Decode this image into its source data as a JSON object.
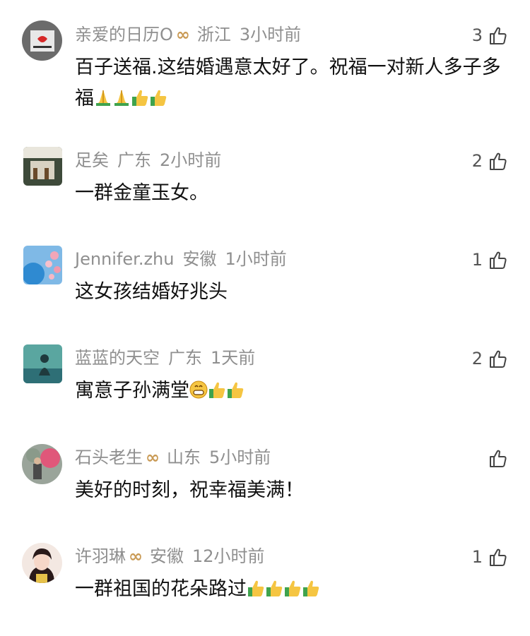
{
  "comments": [
    {
      "user": "亲爱的日历O",
      "badge": "ᴥ",
      "location": "浙江",
      "time": "3小时前",
      "likes": "3",
      "text": "百子送福.这结婚遇意太好了。祝福一对新人多子多福",
      "emojis": [
        "pray",
        "pray",
        "thumb",
        "thumb"
      ]
    },
    {
      "user": "足矣",
      "badge": "",
      "location": "广东",
      "time": "2小时前",
      "likes": "2",
      "text": "一群金童玉女。",
      "emojis": []
    },
    {
      "user": "Jennifer.zhu",
      "badge": "",
      "location": "安徽",
      "time": "1小时前",
      "likes": "1",
      "text": "这女孩结婚好兆头",
      "emojis": []
    },
    {
      "user": "蓝蓝的天空",
      "badge": "",
      "location": "广东",
      "time": "1天前",
      "likes": "2",
      "text": "寓意子孙满堂",
      "emojis": [
        "grin",
        "thumb",
        "thumb"
      ]
    },
    {
      "user": "石头老生",
      "badge": "ᴥ",
      "location": "山东",
      "time": "5小时前",
      "likes": "",
      "text": "美好的时刻，祝幸福美满！",
      "emojis": []
    },
    {
      "user": "许羽琳",
      "badge": "ᴥ",
      "location": "安徽",
      "time": "12小时前",
      "likes": "1",
      "text": "一群祖国的花朵路过",
      "emojis": [
        "thumb",
        "thumb",
        "thumb",
        "thumb"
      ]
    }
  ],
  "icons": {
    "like": "thumbs-up-outline-icon",
    "badge": "vip-badge-icon"
  }
}
